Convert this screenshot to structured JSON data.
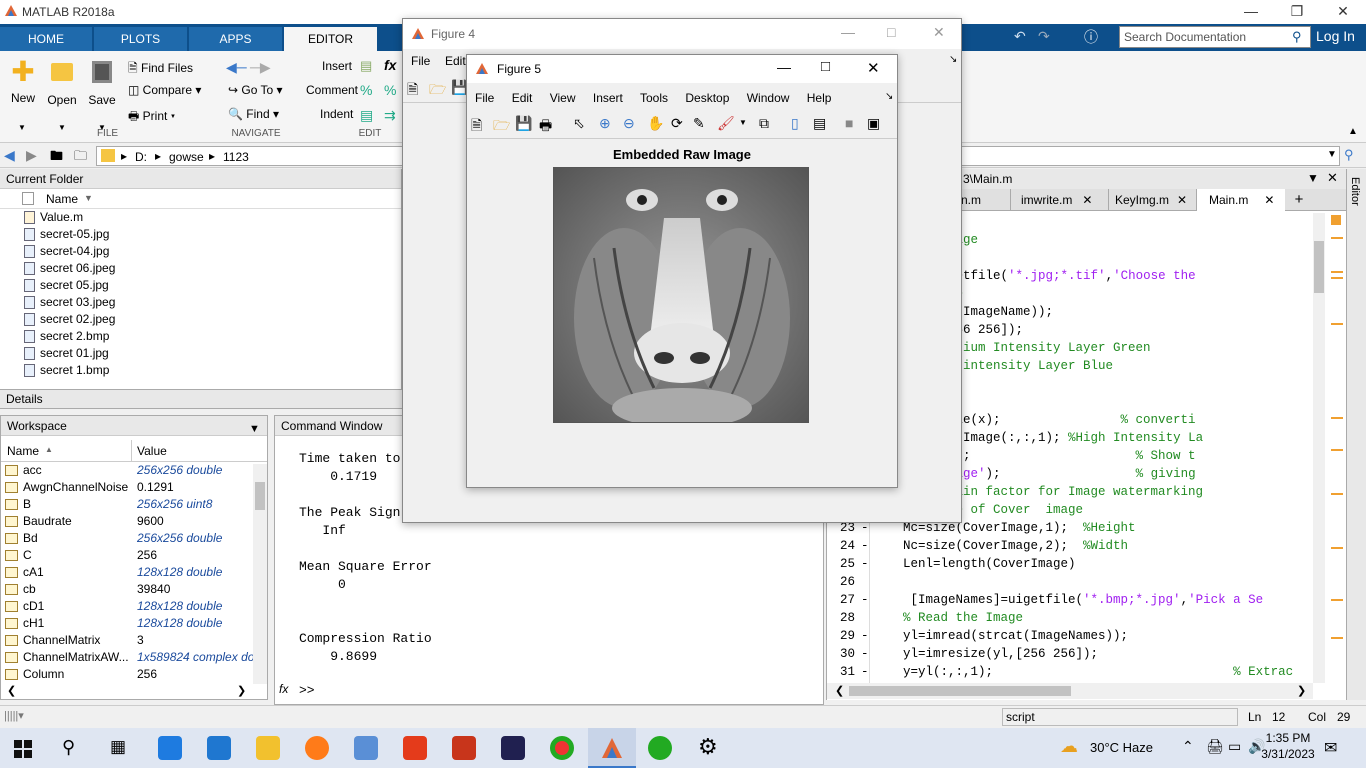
{
  "app": {
    "title": "MATLAB R2018a",
    "search_placeholder": "Search Documentation",
    "login": "Log In"
  },
  "tabs": [
    "HOME",
    "PLOTS",
    "APPS",
    "EDITOR"
  ],
  "ribbon": {
    "new": "New",
    "open": "Open",
    "save": "Save",
    "find_files": "Find Files",
    "compare": "Compare",
    "print": "Print",
    "go_to": "Go To",
    "find": "Find",
    "insert": "Insert",
    "comment": "Comment",
    "indent": "Indent",
    "group_file": "FILE",
    "group_navigate": "NAVIGATE",
    "group_edit": "EDIT"
  },
  "address": {
    "drive": "D:",
    "folder1": "gowse",
    "folder2": "1123"
  },
  "current_folder": {
    "title": "Current Folder",
    "col_name": "Name",
    "files": [
      "Value.m",
      "secret-05.jpg",
      "secret-04.jpg",
      "secret 06.jpeg",
      "secret 05.jpg",
      "secret 03.jpeg",
      "secret 02.jpeg",
      "secret 2.bmp",
      "secret 01.jpg",
      "secret 1.bmp"
    ]
  },
  "details": {
    "title": "Details"
  },
  "workspace": {
    "title": "Workspace",
    "col_name": "Name",
    "col_value": "Value",
    "rows": [
      {
        "name": "acc",
        "value": "256x256 double",
        "italic": true
      },
      {
        "name": "AwgnChannelNoise",
        "value": "0.1291",
        "italic": false
      },
      {
        "name": "B",
        "value": "256x256 uint8",
        "italic": true
      },
      {
        "name": "Baudrate",
        "value": "9600",
        "italic": false
      },
      {
        "name": "Bd",
        "value": "256x256 double",
        "italic": true
      },
      {
        "name": "C",
        "value": "256",
        "italic": false
      },
      {
        "name": "cA1",
        "value": "128x128 double",
        "italic": true
      },
      {
        "name": "cb",
        "value": "39840",
        "italic": false
      },
      {
        "name": "cD1",
        "value": "128x128 double",
        "italic": true
      },
      {
        "name": "cH1",
        "value": "128x128 double",
        "italic": true
      },
      {
        "name": "ChannelMatrix",
        "value": "3",
        "italic": false
      },
      {
        "name": "ChannelMatrixAW...",
        "value": "1x589824 complex do...",
        "italic": true
      },
      {
        "name": "Column",
        "value": "256",
        "italic": false
      }
    ]
  },
  "command_window": {
    "title": "Command Window",
    "lines": [
      "Time taken to",
      "    0.1719",
      "",
      "The Peak Sign",
      "   Inf",
      "",
      "Mean Square Error",
      "     0",
      "",
      "",
      "Compression Ratio",
      "    9.8699"
    ],
    "prompt": ">>"
  },
  "figure4": {
    "title": "Figure 4",
    "menu_file": "File",
    "menu_edit": "Edit"
  },
  "figure5": {
    "title": "Figure 5",
    "menus": [
      "File",
      "Edit",
      "View",
      "Insert",
      "Tools",
      "Desktop",
      "Window",
      "Help"
    ],
    "plot_title": "Embedded Raw Image"
  },
  "editor": {
    "path": "3\\Main.m",
    "tabs": [
      "n.m",
      "imwrite.m",
      "KeyImg.m",
      "Main.m"
    ],
    "lines": [
      {
        "n": "",
        "d": "",
        "t": "he Input Image",
        "k": "com"
      },
      {
        "n": "",
        "d": "",
        "t": "",
        "k": ""
      },
      {
        "n": "",
        "d": "",
        "t": "geName]=uigetfile('*.jpg;*.tif','Choose the",
        "k": "mix1"
      },
      {
        "n": "",
        "d": "",
        "t": "ad the Image",
        "k": "com"
      },
      {
        "n": "",
        "d": "",
        "t": "read(strcat(ImageName));",
        "k": ""
      },
      {
        "n": "",
        "d": "",
        "t": "resize(x,[256 256]);",
        "k": ""
      },
      {
        "n": "",
        "d": "",
        "t": ":,:,2); %Medium Intensity Layer Green",
        "k": "mix2"
      },
      {
        "n": "",
        "d": "",
        "t": ":,:,3);%Low intensity Layer Blue",
        "k": "mix3"
      },
      {
        "n": "",
        "d": "",
        "t": "ouble(G);",
        "k": ""
      },
      {
        "n": "",
        "d": "",
        "t": "ouble(B);",
        "k": ""
      },
      {
        "n": "",
        "d": "",
        "t": "rImage=double(x);                % converti",
        "k": "mix4"
      },
      {
        "n": "",
        "d": "",
        "t": "rImage=CoverImage(:,:,1); %High Intensity La",
        "k": "mix5"
      },
      {
        "n": "",
        "d": "",
        "t": "re,imshow(x);                      % Show t",
        "k": "mix6"
      },
      {
        "n": "",
        "d": "",
        "t": "e('Cover Image');                  % giving",
        "k": "mix7"
      },
      {
        "n": "",
        "d": "",
        "t": "% set the gain factor for Image watermarking",
        "k": "com"
      },
      {
        "n": "",
        "d": "",
        "t": "termine size of Cover  image",
        "k": "com"
      },
      {
        "n": "23",
        "d": "-",
        "t": "    Mc=size(CoverImage,1);  %Height",
        "k": "mix8"
      },
      {
        "n": "24",
        "d": "-",
        "t": "    Nc=size(CoverImage,2);  %Width",
        "k": "mix9"
      },
      {
        "n": "25",
        "d": "-",
        "t": "    Lenl=length(CoverImage)",
        "k": ""
      },
      {
        "n": "26",
        "d": "",
        "t": "",
        "k": ""
      },
      {
        "n": "27",
        "d": "-",
        "t": "     [ImageNames]=uigetfile('*.bmp;*.jpg','Pick a Se",
        "k": "mix10"
      },
      {
        "n": "28",
        "d": "",
        "t": "    % Read the Image",
        "k": "com"
      },
      {
        "n": "29",
        "d": "-",
        "t": "    yl=imread(strcat(ImageNames));",
        "k": ""
      },
      {
        "n": "30",
        "d": "-",
        "t": "    yl=imresize(yl,[256 256]);",
        "k": ""
      },
      {
        "n": "31",
        "d": "-",
        "t": "    y=yl(:,:,1);                                % Extrac",
        "k": "mix11"
      }
    ],
    "side_label": "Editor"
  },
  "status": {
    "mode": "script",
    "ln_label": "Ln",
    "ln": "12",
    "col_label": "Col",
    "col": "29"
  },
  "taskbar": {
    "weather": "30°C  Haze",
    "time": "1:35 PM",
    "date": "3/31/2023"
  }
}
